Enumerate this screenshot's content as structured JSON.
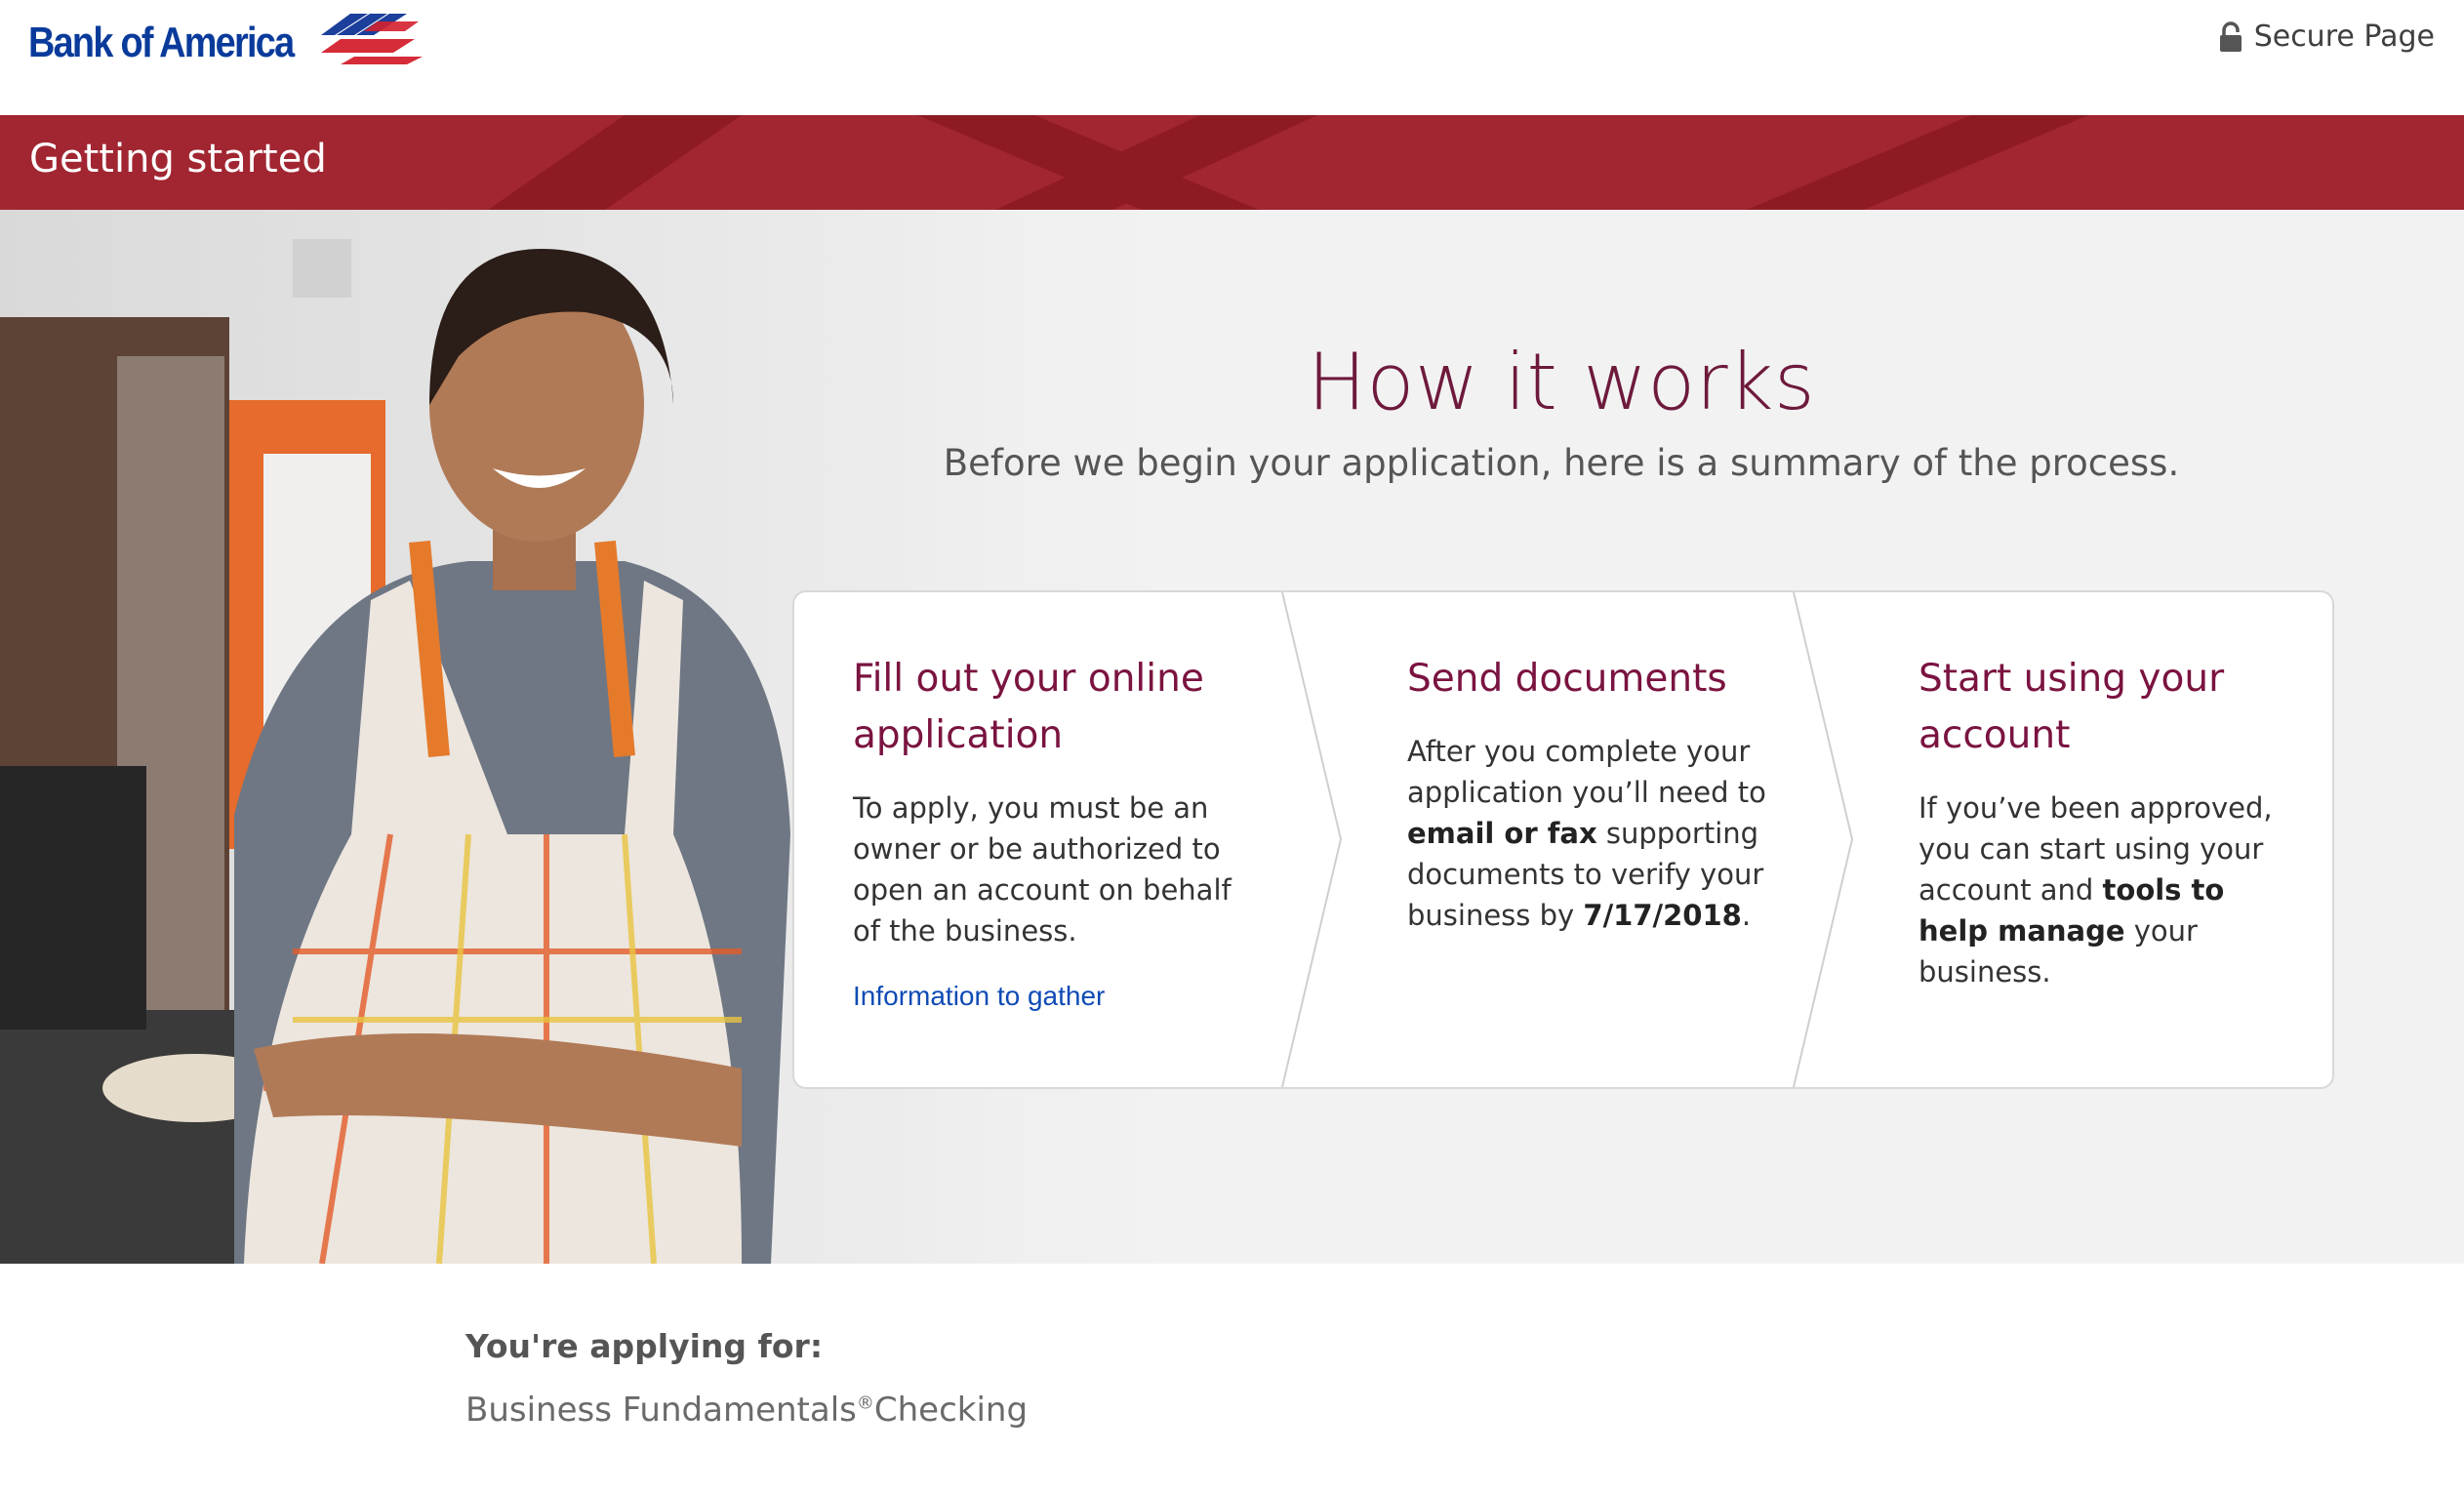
{
  "header": {
    "logo_text": "Bank of America",
    "secure_label": "Secure Page",
    "secure_icon": "lock-icon"
  },
  "band": {
    "title": "Getting started"
  },
  "hero": {
    "title": "How it works",
    "subtitle": "Before we begin your application, here is a summary of the process."
  },
  "steps": [
    {
      "title": "Fill out your online application",
      "body": "To apply, you must be an owner or be authorized to open an account on behalf of the business.",
      "link": "Information to gather"
    },
    {
      "title": "Send documents",
      "body_pre": "After you complete your application you’ll need to ",
      "body_bold1": "email or fax",
      "body_mid": " supporting documents to verify your business by ",
      "body_bold2": "7/17/2018",
      "body_post": "."
    },
    {
      "title": "Start using your account",
      "body_pre": "If you’ve been approved, you can start using your account and ",
      "body_bold": "tools to help manage",
      "body_post": " your business."
    }
  ],
  "applying": {
    "heading": "You're applying for:",
    "product_pre": "Business Fundamentals",
    "product_mark": "®",
    "product_post": "Checking"
  },
  "colors": {
    "brand_red": "#a12631",
    "brand_navy": "#0a3b9b",
    "heading_maroon": "#7a1340",
    "link_blue": "#0f4bb5"
  }
}
